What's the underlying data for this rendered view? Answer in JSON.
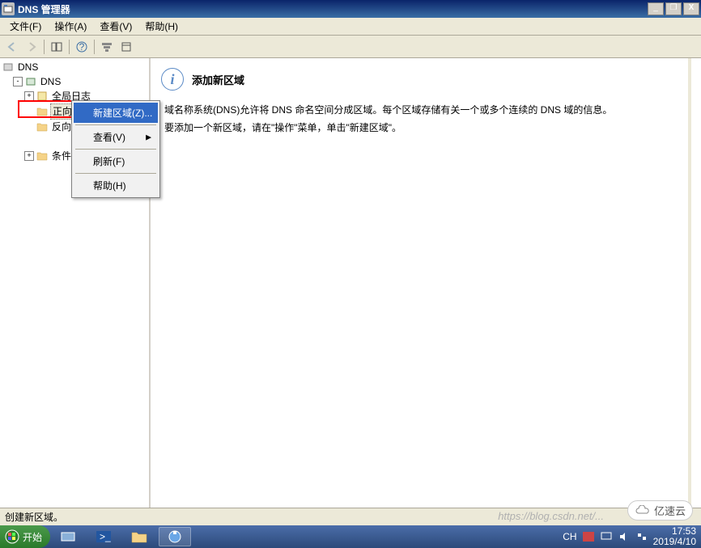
{
  "window": {
    "title": "DNS 管理器",
    "menus": {
      "file": "文件(F)",
      "action": "操作(A)",
      "view": "查看(V)",
      "help": "帮助(H)"
    }
  },
  "tree": {
    "root": "DNS",
    "server": "DNS",
    "global_log": "全局日志",
    "forward": "正向查找区域",
    "reverse": "反向查找区域",
    "other": "条件转发器"
  },
  "ctx": {
    "new_zone": "新建区域(Z)...",
    "view": "查看(V)",
    "refresh": "刷新(F)",
    "help": "帮助(H)"
  },
  "content": {
    "heading": "添加新区域",
    "p1": "域名称系统(DNS)允许将 DNS 命名空间分成区域。每个区域存储有关一个或多个连续的 DNS 域的信息。",
    "p2": "要添加一个新区域，请在\"操作\"菜单，单击\"新建区域\"。"
  },
  "status": "创建新区域。",
  "taskbar": {
    "start": "开始",
    "lang": "CH",
    "time": "17:53",
    "date": "2019/4/10"
  },
  "watermarks": {
    "csdn": "https://blog.csdn.net/...",
    "yisu": "亿速云"
  }
}
